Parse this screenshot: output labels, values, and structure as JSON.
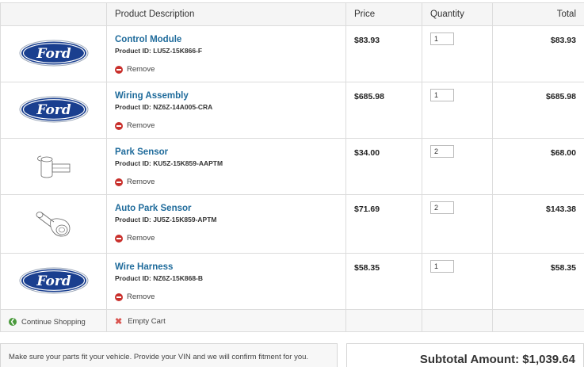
{
  "header": {
    "description": "Product Description",
    "price": "Price",
    "quantity": "Quantity",
    "total": "Total"
  },
  "items": [
    {
      "name": "Control Module",
      "id_label": "Product ID:",
      "id": "LU5Z-15K866-F",
      "remove": "Remove",
      "price": "$83.93",
      "quantity": "1",
      "total": "$83.93",
      "image": "ford-logo"
    },
    {
      "name": "Wiring Assembly",
      "id_label": "Product ID:",
      "id": "NZ6Z-14A005-CRA",
      "remove": "Remove",
      "price": "$685.98",
      "quantity": "1",
      "total": "$685.98",
      "image": "ford-logo"
    },
    {
      "name": "Park Sensor",
      "id_label": "Product ID:",
      "id": "KU5Z-15K859-AAPTM",
      "remove": "Remove",
      "price": "$34.00",
      "quantity": "2",
      "total": "$68.00",
      "image": "sensor-drawing"
    },
    {
      "name": "Auto Park Sensor",
      "id_label": "Product ID:",
      "id": "JU5Z-15K859-APTM",
      "remove": "Remove",
      "price": "$71.69",
      "quantity": "2",
      "total": "$143.38",
      "image": "sensor-drawing"
    },
    {
      "name": "Wire Harness",
      "id_label": "Product ID:",
      "id": "NZ6Z-15K868-B",
      "remove": "Remove",
      "price": "$58.35",
      "quantity": "1",
      "total": "$58.35",
      "image": "ford-logo"
    }
  ],
  "footer": {
    "continue": "Continue Shopping",
    "empty": "Empty Cart"
  },
  "vin_note": "Make sure your parts fit your vehicle. Provide your VIN and we will confirm fitment for you.",
  "subtotal": "Subtotal Amount: $1,039.64",
  "logo_text": "Ford",
  "colors": {
    "link": "#1f6b9b",
    "remove": "#c9302c",
    "continue": "#4a9a3c",
    "ford_blue": "#1a3f8f"
  }
}
